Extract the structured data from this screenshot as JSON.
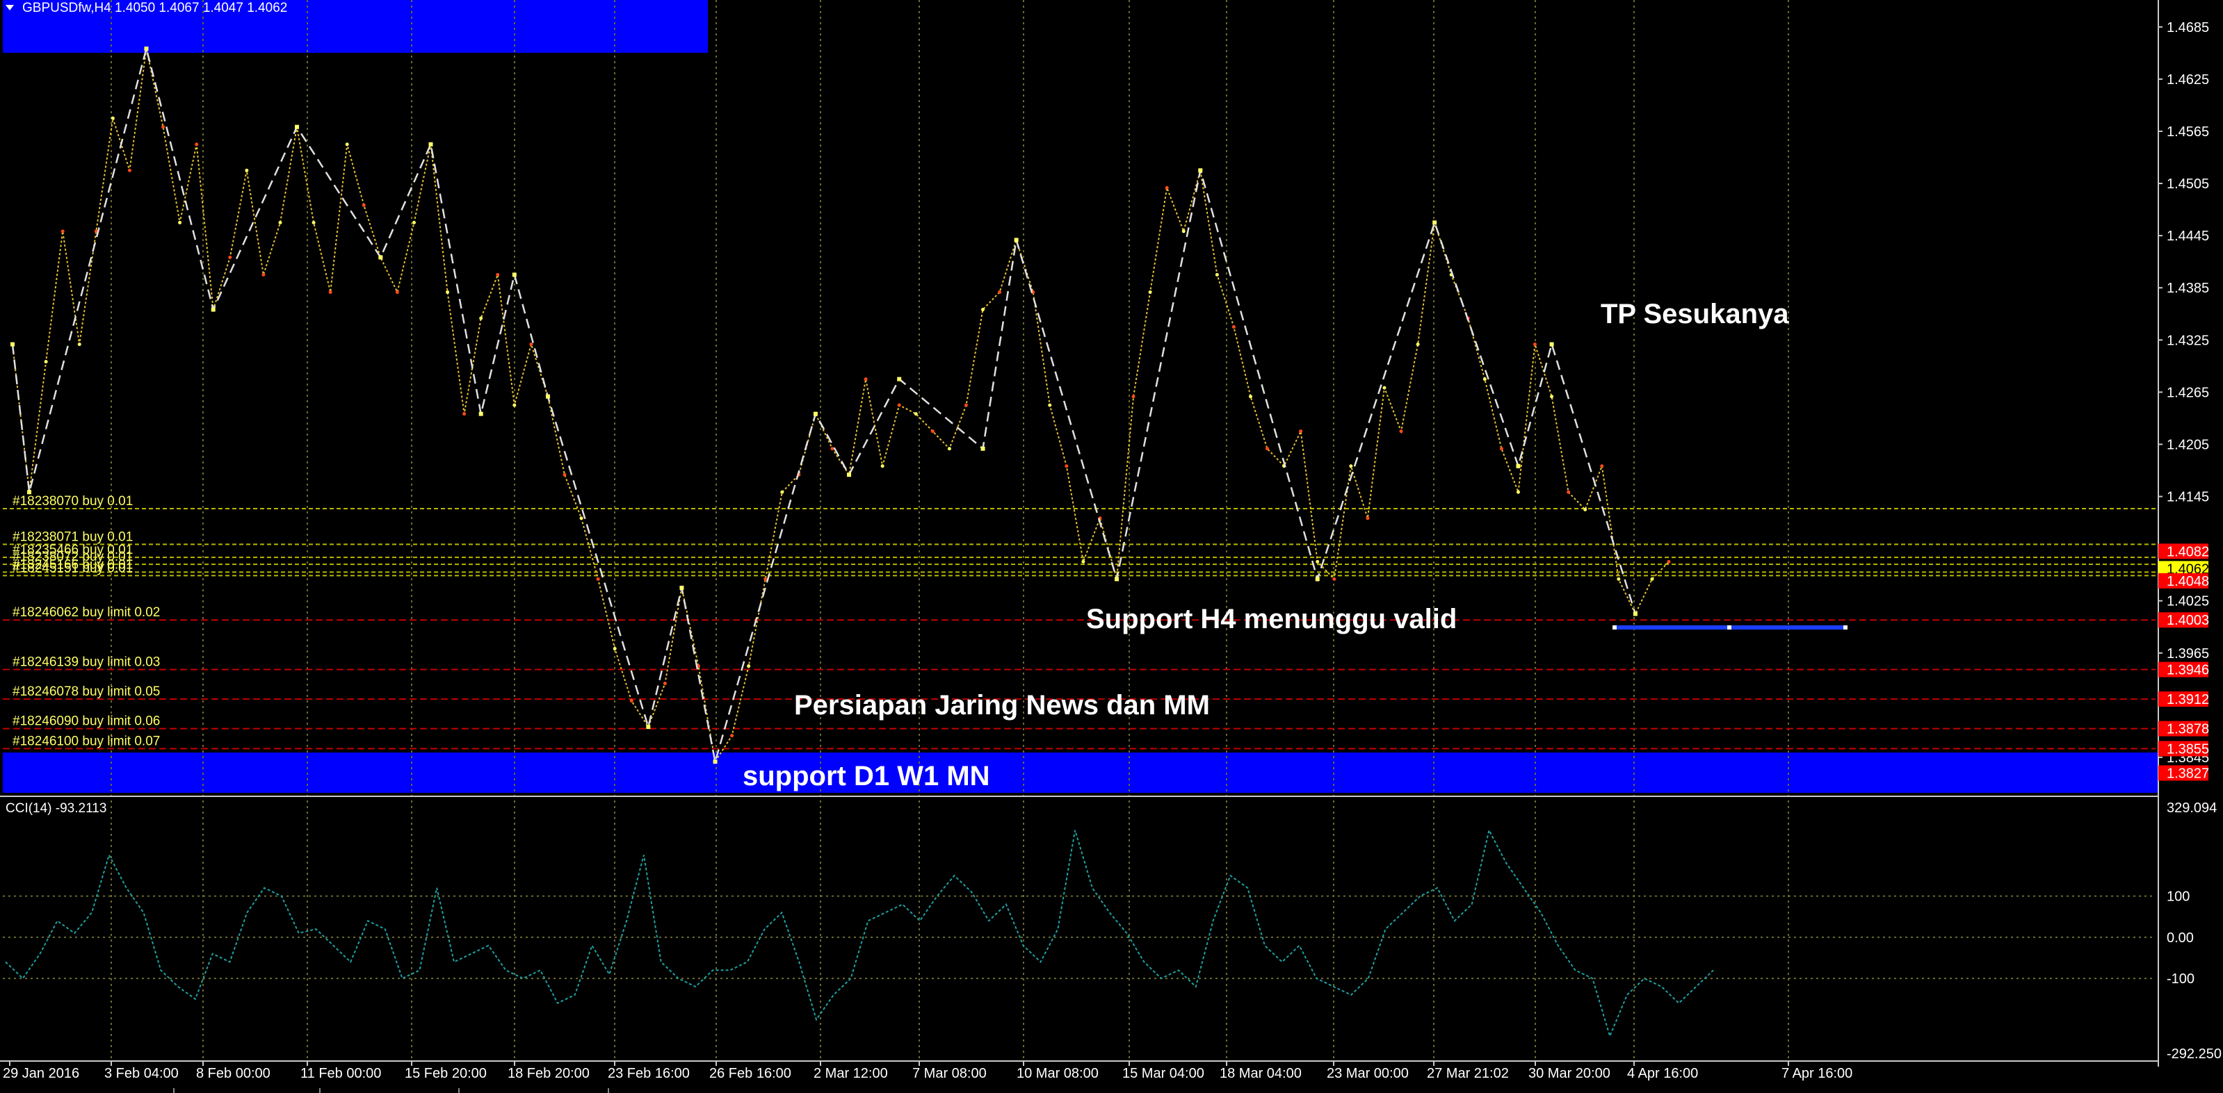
{
  "header": {
    "symbol_line": "GBPUSDfw,H4  1.4050 1.4067 1.4047 1.4062",
    "menu_icon": "triangle-down-icon"
  },
  "colors": {
    "background": "#000000",
    "zone_blue": "#0000ff",
    "grid": "#6b6b2e",
    "price_line": "#e8c230",
    "zigzag": "#e0e0e0",
    "fractal_up": "#ffff66",
    "fractal_down": "#ff4a1a",
    "buy_line": "#b8b800",
    "limit_line": "#c00000",
    "price_tag": "#ff0000",
    "current_price_tag": "#ffff00",
    "cci_line": "#1fa0a0",
    "axis_text": "#ffffff",
    "annotation_text": "#ffffff"
  },
  "price_axis": {
    "ticks": [
      "1.4685",
      "1.4625",
      "1.4565",
      "1.4505",
      "1.4445",
      "1.4385",
      "1.4325",
      "1.4265",
      "1.4205",
      "1.4145",
      "1.4085",
      "1.4025",
      "1.3965",
      "1.3845"
    ],
    "tags": [
      {
        "label": "1.4082",
        "kind": "red"
      },
      {
        "label": "1.4062",
        "kind": "current"
      },
      {
        "label": "1.4048",
        "kind": "red"
      },
      {
        "label": "1.4003",
        "kind": "red"
      },
      {
        "label": "1.3946",
        "kind": "red"
      },
      {
        "label": "1.3912",
        "kind": "red"
      },
      {
        "label": "1.3878",
        "kind": "red"
      },
      {
        "label": "1.3855",
        "kind": "red"
      },
      {
        "label": "1.3827",
        "kind": "red"
      }
    ]
  },
  "orders": [
    "#18238070 buy 0.01",
    "#18238071 buy 0.01",
    "#18235466 buy 0.01",
    "#18238072 buy 0.01",
    "#18245166 buy 0.01",
    "#18245151 buy 0.01",
    "#18246062 buy limit 0.02",
    "#18246139 buy limit 0.03",
    "#18246078 buy limit 0.05",
    "#18246090 buy limit 0.06",
    "#18246100 buy limit 0.07"
  ],
  "annotations": {
    "tp": "TP Sesukanya",
    "support_h4": "Support H4 menunggu valid",
    "persiapan": "Persiapan Jaring News dan MM",
    "support_d1": "support D1 W1 MN"
  },
  "indicator": {
    "label": "CCI(14) -93.2113",
    "ticks": [
      "329.094",
      "100",
      "0.00",
      "-100",
      "-292.250"
    ]
  },
  "time_axis": [
    "29 Jan 2016",
    "3 Feb 04:00",
    "8 Feb 00:00",
    "11 Feb 00:00",
    "15 Feb 20:00",
    "18 Feb 20:00",
    "23 Feb 16:00",
    "26 Feb 16:00",
    "2 Mar 12:00",
    "7 Mar 08:00",
    "10 Mar 08:00",
    "15 Mar 04:00",
    "18 Mar 04:00",
    "23 Mar 00:00",
    "27 Mar 21:02",
    "30 Mar 20:00",
    "4 Apr 16:00",
    "7 Apr 16:00"
  ],
  "chart_data": {
    "type": "line",
    "symbol": "GBPUSDfw",
    "timeframe": "H4",
    "ohlc_last": {
      "open": 1.405,
      "high": 1.4067,
      "low": 1.4047,
      "close": 1.4062
    },
    "price_range": [
      1.3805,
      1.47
    ],
    "price_series": [
      1.432,
      1.415,
      1.43,
      1.445,
      1.432,
      1.445,
      1.458,
      1.452,
      1.466,
      1.457,
      1.446,
      1.455,
      1.436,
      1.442,
      1.452,
      1.44,
      1.446,
      1.457,
      1.446,
      1.438,
      1.455,
      1.448,
      1.442,
      1.438,
      1.446,
      1.455,
      1.438,
      1.424,
      1.435,
      1.44,
      1.425,
      1.432,
      1.426,
      1.417,
      1.412,
      1.405,
      1.397,
      1.391,
      1.388,
      1.393,
      1.404,
      1.395,
      1.384,
      1.387,
      1.395,
      1.405,
      1.415,
      1.417,
      1.424,
      1.42,
      1.417,
      1.428,
      1.418,
      1.425,
      1.424,
      1.422,
      1.42,
      1.425,
      1.436,
      1.438,
      1.444,
      1.438,
      1.425,
      1.418,
      1.407,
      1.412,
      1.405,
      1.426,
      1.438,
      1.45,
      1.445,
      1.452,
      1.44,
      1.434,
      1.426,
      1.42,
      1.418,
      1.422,
      1.407,
      1.405,
      1.418,
      1.412,
      1.427,
      1.422,
      1.432,
      1.446,
      1.44,
      1.435,
      1.428,
      1.42,
      1.415,
      1.432,
      1.426,
      1.415,
      1.413,
      1.418,
      1.405,
      1.401,
      1.405,
      1.407
    ],
    "zigzag": [
      [
        0,
        1.432
      ],
      [
        1,
        1.415
      ],
      [
        8,
        1.466
      ],
      [
        12,
        1.436
      ],
      [
        17,
        1.457
      ],
      [
        22,
        1.442
      ],
      [
        25,
        1.455
      ],
      [
        28,
        1.424
      ],
      [
        30,
        1.44
      ],
      [
        32,
        1.426
      ],
      [
        38,
        1.388
      ],
      [
        40,
        1.404
      ],
      [
        42,
        1.384
      ],
      [
        48,
        1.424
      ],
      [
        50,
        1.417
      ],
      [
        53,
        1.428
      ],
      [
        58,
        1.42
      ],
      [
        60,
        1.444
      ],
      [
        66,
        1.405
      ],
      [
        71,
        1.452
      ],
      [
        78,
        1.405
      ],
      [
        85,
        1.446
      ],
      [
        90,
        1.418
      ],
      [
        92,
        1.432
      ],
      [
        97,
        1.401
      ]
    ],
    "order_levels": [
      {
        "label": "#18238070 buy 0.01",
        "price": 1.4131,
        "type": "buy"
      },
      {
        "label": "#18238071 buy 0.01",
        "price": 1.409,
        "type": "buy"
      },
      {
        "label": "#18235466 buy 0.01",
        "price": 1.4075,
        "type": "buy"
      },
      {
        "label": "#18238072 buy 0.01",
        "price": 1.4067,
        "type": "buy"
      },
      {
        "label": "#18245166 buy 0.01",
        "price": 1.4058,
        "type": "buy"
      },
      {
        "label": "#18245151 buy 0.01",
        "price": 1.4054,
        "type": "buy"
      },
      {
        "label": "#18246062 buy limit 0.02",
        "price": 1.4003,
        "type": "limit"
      },
      {
        "label": "#18246139 buy limit 0.03",
        "price": 1.3946,
        "type": "limit"
      },
      {
        "label": "#18246078 buy limit 0.05",
        "price": 1.3912,
        "type": "limit"
      },
      {
        "label": "#18246090 buy limit 0.06",
        "price": 1.3878,
        "type": "limit"
      },
      {
        "label": "#18246100 buy limit 0.07",
        "price": 1.3855,
        "type": "limit"
      }
    ],
    "support_zone_d1": [
      1.3827,
      1.3868
    ],
    "support_h4_line": 1.4,
    "cci_range": [
      -292.25,
      329.094
    ],
    "cci": [
      -60,
      -100,
      -40,
      40,
      10,
      60,
      200,
      120,
      60,
      -80,
      -120,
      -150,
      -40,
      -60,
      60,
      120,
      100,
      10,
      20,
      -20,
      -60,
      40,
      20,
      -100,
      -80,
      120,
      -60,
      -40,
      -20,
      -80,
      -100,
      -80,
      -160,
      -140,
      -20,
      -90,
      40,
      200,
      -60,
      -100,
      -120,
      -80,
      -80,
      -60,
      20,
      60,
      -60,
      -200,
      -140,
      -100,
      40,
      60,
      80,
      40,
      100,
      150,
      110,
      40,
      80,
      -20,
      -60,
      20,
      260,
      120,
      60,
      10,
      -60,
      -100,
      -80,
      -120,
      40,
      150,
      120,
      -20,
      -60,
      -20,
      -100,
      -120,
      -140,
      -100,
      20,
      60,
      100,
      120,
      40,
      80,
      260,
      180,
      120,
      60,
      -20,
      -80,
      -100,
      -240,
      -140,
      -100,
      -120,
      -160,
      -120,
      -80
    ]
  }
}
